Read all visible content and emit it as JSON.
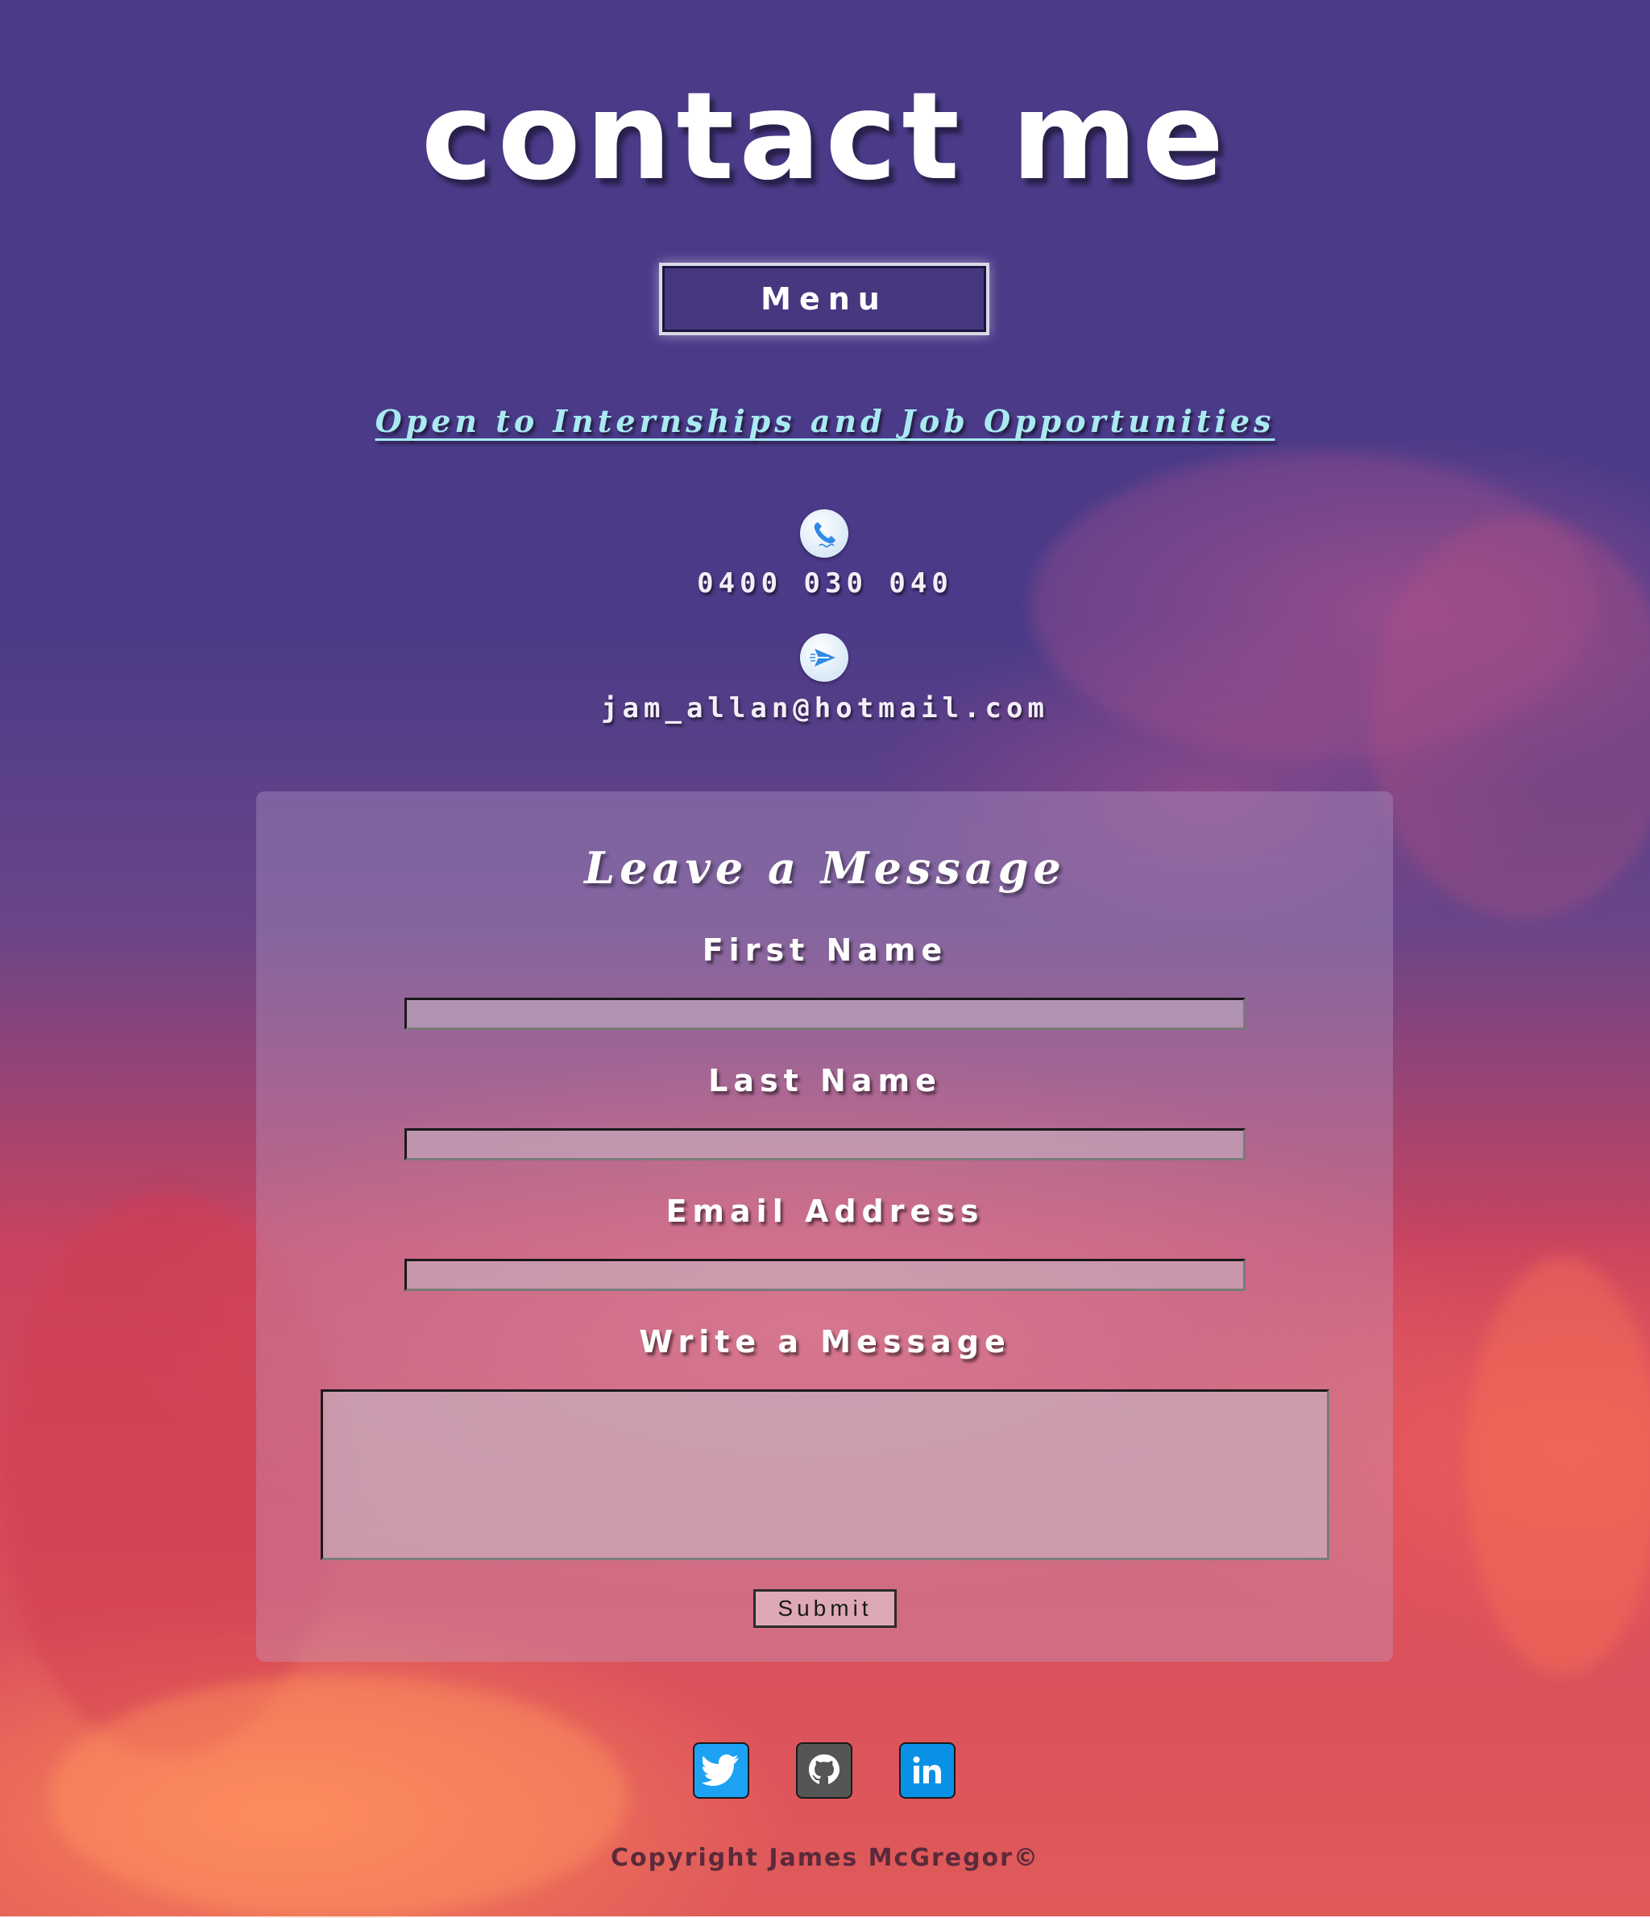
{
  "header": {
    "title": "contact me",
    "menu_label": "Menu"
  },
  "banner": {
    "text": "Open to Internships and Job Opportunities"
  },
  "contact": {
    "phone_icon": "phone-icon",
    "phone": "0400 030 040",
    "email_icon": "send-icon",
    "email": "jam_allan@hotmail.com"
  },
  "form": {
    "title": "Leave a Message",
    "first_name_label": "First Name",
    "first_name_value": "",
    "last_name_label": "Last Name",
    "last_name_value": "",
    "email_label": "Email Address",
    "email_value": "",
    "message_label": "Write a Message",
    "message_value": "",
    "submit_label": "Submit"
  },
  "social": {
    "items": [
      {
        "name": "twitter-icon",
        "color": "#1da1f2"
      },
      {
        "name": "github-icon",
        "color": "#555555"
      },
      {
        "name": "linkedin-icon",
        "color": "#0a91e6"
      }
    ]
  },
  "footer": {
    "copyright": "Copyright James McGregor©"
  },
  "colors": {
    "background_top": "#4a3a88",
    "background_bottom": "#e05a5a",
    "menu_button": "#46377f",
    "banner_text": "#a9eaf2",
    "copyright_text": "#5a2a3a"
  }
}
